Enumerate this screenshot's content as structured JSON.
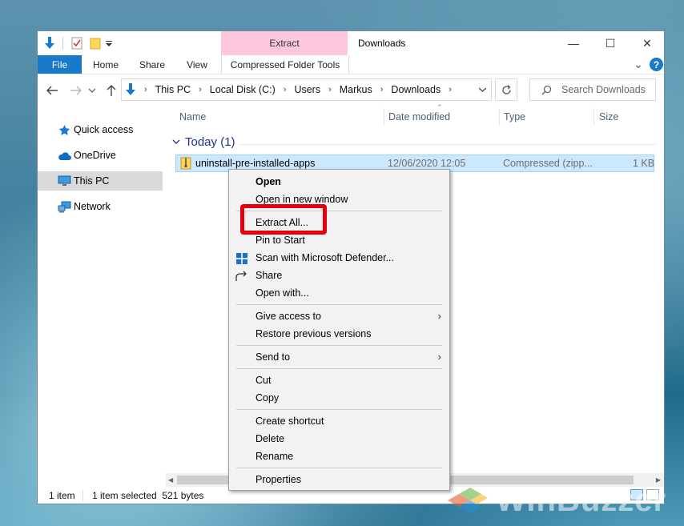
{
  "window": {
    "title": "Downloads",
    "context_tab": "Extract",
    "controls": {
      "minimize": "—",
      "maximize": "☐",
      "close": "✕"
    }
  },
  "ribbon": {
    "tabs": [
      "File",
      "Home",
      "Share",
      "View"
    ],
    "contextual_tab": "Compressed Folder Tools",
    "collapse_glyph": "⌄",
    "help_glyph": "?"
  },
  "address": {
    "crumbs": [
      "This PC",
      "Local Disk (C:)",
      "Users",
      "Markus",
      "Downloads"
    ],
    "search_placeholder": "Search Downloads"
  },
  "sidebar": {
    "items": [
      {
        "label": "Quick access",
        "icon": "star-icon"
      },
      {
        "label": "OneDrive",
        "icon": "cloud-icon"
      },
      {
        "label": "This PC",
        "icon": "monitor-icon",
        "selected": true
      },
      {
        "label": "Network",
        "icon": "network-icon"
      }
    ]
  },
  "columns": [
    "Name",
    "Date modified",
    "Type",
    "Size"
  ],
  "group": {
    "label": "Today (1)"
  },
  "files": [
    {
      "name": "uninstall-pre-installed-apps",
      "date": "12/06/2020 12:05",
      "type": "Compressed (zipp...",
      "size": "1 KB"
    }
  ],
  "status": {
    "count": "1 item",
    "selected": "1 item selected  521 bytes"
  },
  "context_menu": {
    "items": {
      "open": "Open",
      "open_new_window": "Open in new window",
      "extract_all": "Extract All...",
      "pin_to_start": "Pin to Start",
      "scan_defender": "Scan with Microsoft Defender...",
      "share": "Share",
      "open_with": "Open with...",
      "give_access": "Give access to",
      "restore_versions": "Restore previous versions",
      "send_to": "Send to",
      "cut": "Cut",
      "copy": "Copy",
      "create_shortcut": "Create shortcut",
      "delete": "Delete",
      "rename": "Rename",
      "properties": "Properties"
    },
    "submenu_arrow": "›"
  },
  "watermark": {
    "text": "WinBuzzer"
  },
  "colors": {
    "accent": "#1979ca",
    "context_tab": "#fdc7dd",
    "selection": "#cce8ff",
    "highlight_box": "#e3000f"
  }
}
